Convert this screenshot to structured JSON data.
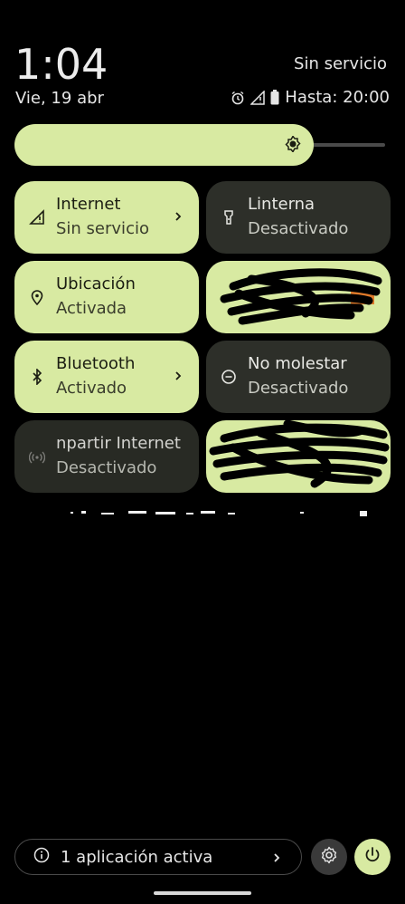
{
  "status": {
    "time": "1:04",
    "date": "Vie, 19 abr",
    "carrier": "Sin servicio",
    "alarm_text": "Hasta: 20:00"
  },
  "brightness": {
    "level": 0.78
  },
  "tiles": [
    {
      "title": "Internet",
      "subtitle": "Sin servicio",
      "state": "on",
      "icon": "signal-off-icon",
      "has_chevron": true
    },
    {
      "title": "Linterna",
      "subtitle": "Desactivado",
      "state": "off",
      "icon": "flashlight-icon",
      "has_chevron": false
    },
    {
      "title": "Ubicación",
      "subtitle": "Activada",
      "state": "on",
      "icon": "location-pin-icon",
      "has_chevron": false
    },
    {
      "title": "",
      "subtitle": "",
      "state": "redacted",
      "icon": "",
      "has_chevron": false
    },
    {
      "title": "Bluetooth",
      "subtitle": "Activado",
      "state": "on",
      "icon": "bluetooth-icon",
      "has_chevron": true
    },
    {
      "title": "No molestar",
      "subtitle": "Desactivado",
      "state": "off",
      "icon": "do-not-disturb-icon",
      "has_chevron": false
    },
    {
      "title": "npartir Internet",
      "subtitle": "Desactivado",
      "state": "off",
      "icon": "hotspot-icon",
      "has_chevron": false
    },
    {
      "title": "",
      "subtitle": "",
      "state": "redacted",
      "icon": "",
      "has_chevron": false
    }
  ],
  "footer": {
    "active_apps": "1 aplicación activa"
  },
  "colors": {
    "accent": "#d8eaa2",
    "tile_off": "#2d2f29",
    "background": "#000000"
  }
}
